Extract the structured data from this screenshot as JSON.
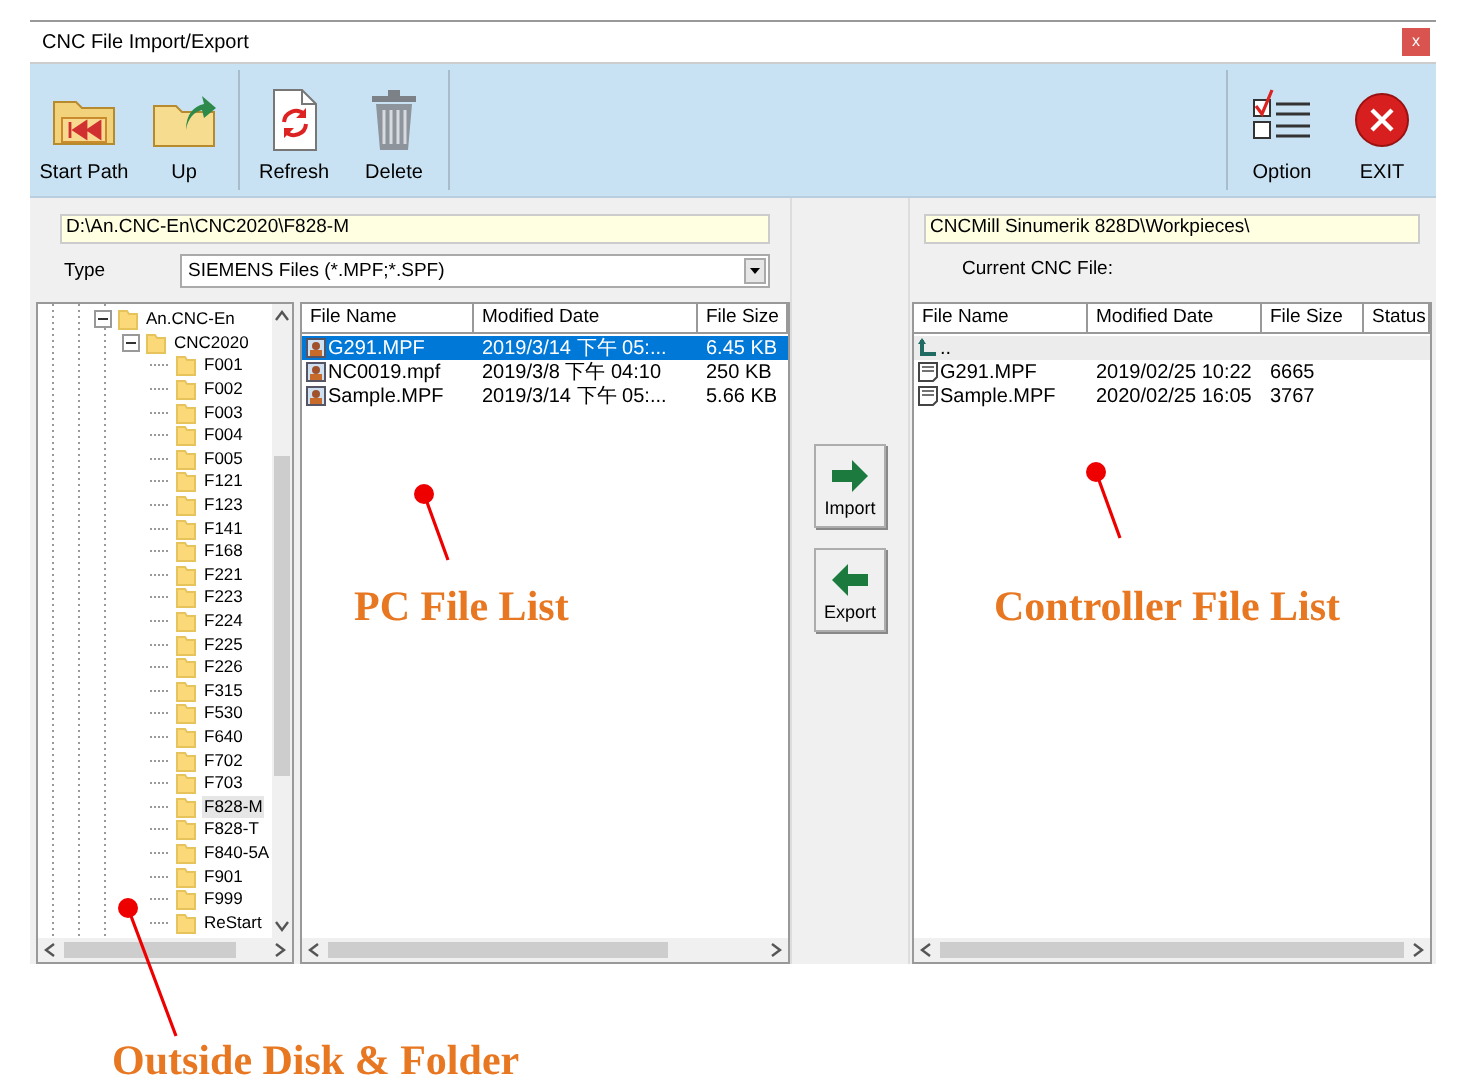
{
  "window": {
    "title": "CNC File Import/Export",
    "close": "x"
  },
  "toolbar": {
    "left": [
      [
        {
          "label": "Start Path",
          "kind": "start"
        },
        {
          "label": "Up",
          "kind": "up"
        }
      ],
      [
        {
          "label": "Refresh",
          "kind": "refresh"
        },
        {
          "label": "Delete",
          "kind": "delete"
        }
      ]
    ],
    "right": [
      {
        "label": "Option",
        "kind": "option"
      },
      {
        "label": "EXIT",
        "kind": "exit"
      }
    ]
  },
  "pc": {
    "path": "D:\\An.CNC-En\\CNC2020\\F828-M",
    "type_label": "Type",
    "type_value": "SIEMENS Files (*.MPF;*.SPF)"
  },
  "tree": [
    {
      "label": "An.CNC-En",
      "expanded": true,
      "selected": false,
      "children": [
        {
          "label": "CNC2020",
          "expanded": true,
          "selected": false,
          "children": [
            {
              "label": "F001",
              "selected": false
            },
            {
              "label": "F002",
              "selected": false
            },
            {
              "label": "F003",
              "selected": false
            },
            {
              "label": "F004",
              "selected": false
            },
            {
              "label": "F005",
              "selected": false
            },
            {
              "label": "F121",
              "selected": false
            },
            {
              "label": "F123",
              "selected": false
            },
            {
              "label": "F141",
              "selected": false
            },
            {
              "label": "F168",
              "selected": false
            },
            {
              "label": "F221",
              "selected": false
            },
            {
              "label": "F223",
              "selected": false
            },
            {
              "label": "F224",
              "selected": false
            },
            {
              "label": "F225",
              "selected": false
            },
            {
              "label": "F226",
              "selected": false
            },
            {
              "label": "F315",
              "selected": false
            },
            {
              "label": "F530",
              "selected": false
            },
            {
              "label": "F640",
              "selected": false
            },
            {
              "label": "F702",
              "selected": false
            },
            {
              "label": "F703",
              "selected": false
            },
            {
              "label": "F828-M",
              "selected": true
            },
            {
              "label": "F828-T",
              "selected": false
            },
            {
              "label": "F840-5A",
              "selected": false
            },
            {
              "label": "F901",
              "selected": false
            },
            {
              "label": "F999",
              "selected": false
            },
            {
              "label": "ReStart",
              "selected": false
            }
          ]
        }
      ]
    }
  ],
  "pc_files": {
    "columns": [
      "File Name",
      "Modified Date",
      "File Size"
    ],
    "rows": [
      {
        "cells": [
          "G291.MPF",
          "2019/3/14 下午 05:...",
          "6.45 KB"
        ],
        "selected": true
      },
      {
        "cells": [
          "NC0019.mpf",
          "2019/3/8 下午 04:10",
          "250 KB"
        ],
        "selected": false
      },
      {
        "cells": [
          "Sample.MPF",
          "2019/3/14 下午 05:...",
          "5.66 KB"
        ],
        "selected": false
      }
    ]
  },
  "transfer": [
    {
      "label": "Import",
      "kind": "import"
    },
    {
      "label": "Export",
      "kind": "export"
    }
  ],
  "cnc": {
    "path": "CNCMill Sinumerik 828D\\Workpieces\\",
    "current_label": "Current CNC File:"
  },
  "cnc_files": {
    "columns": [
      "File Name",
      "Modified Date",
      "File Size",
      "Status"
    ],
    "rows": [
      {
        "kind": "parent",
        "cells": [
          ".."
        ],
        "selected": true
      },
      {
        "kind": "file",
        "cells": [
          "G291.MPF",
          "2019/02/25 10:22",
          "6665"
        ],
        "selected": false
      },
      {
        "kind": "file",
        "cells": [
          "Sample.MPF",
          "2020/02/25 16:05",
          "3767"
        ],
        "selected": false
      }
    ]
  },
  "annotations": [
    "PC File List",
    "Controller File List",
    "Outside Disk & Folder"
  ]
}
